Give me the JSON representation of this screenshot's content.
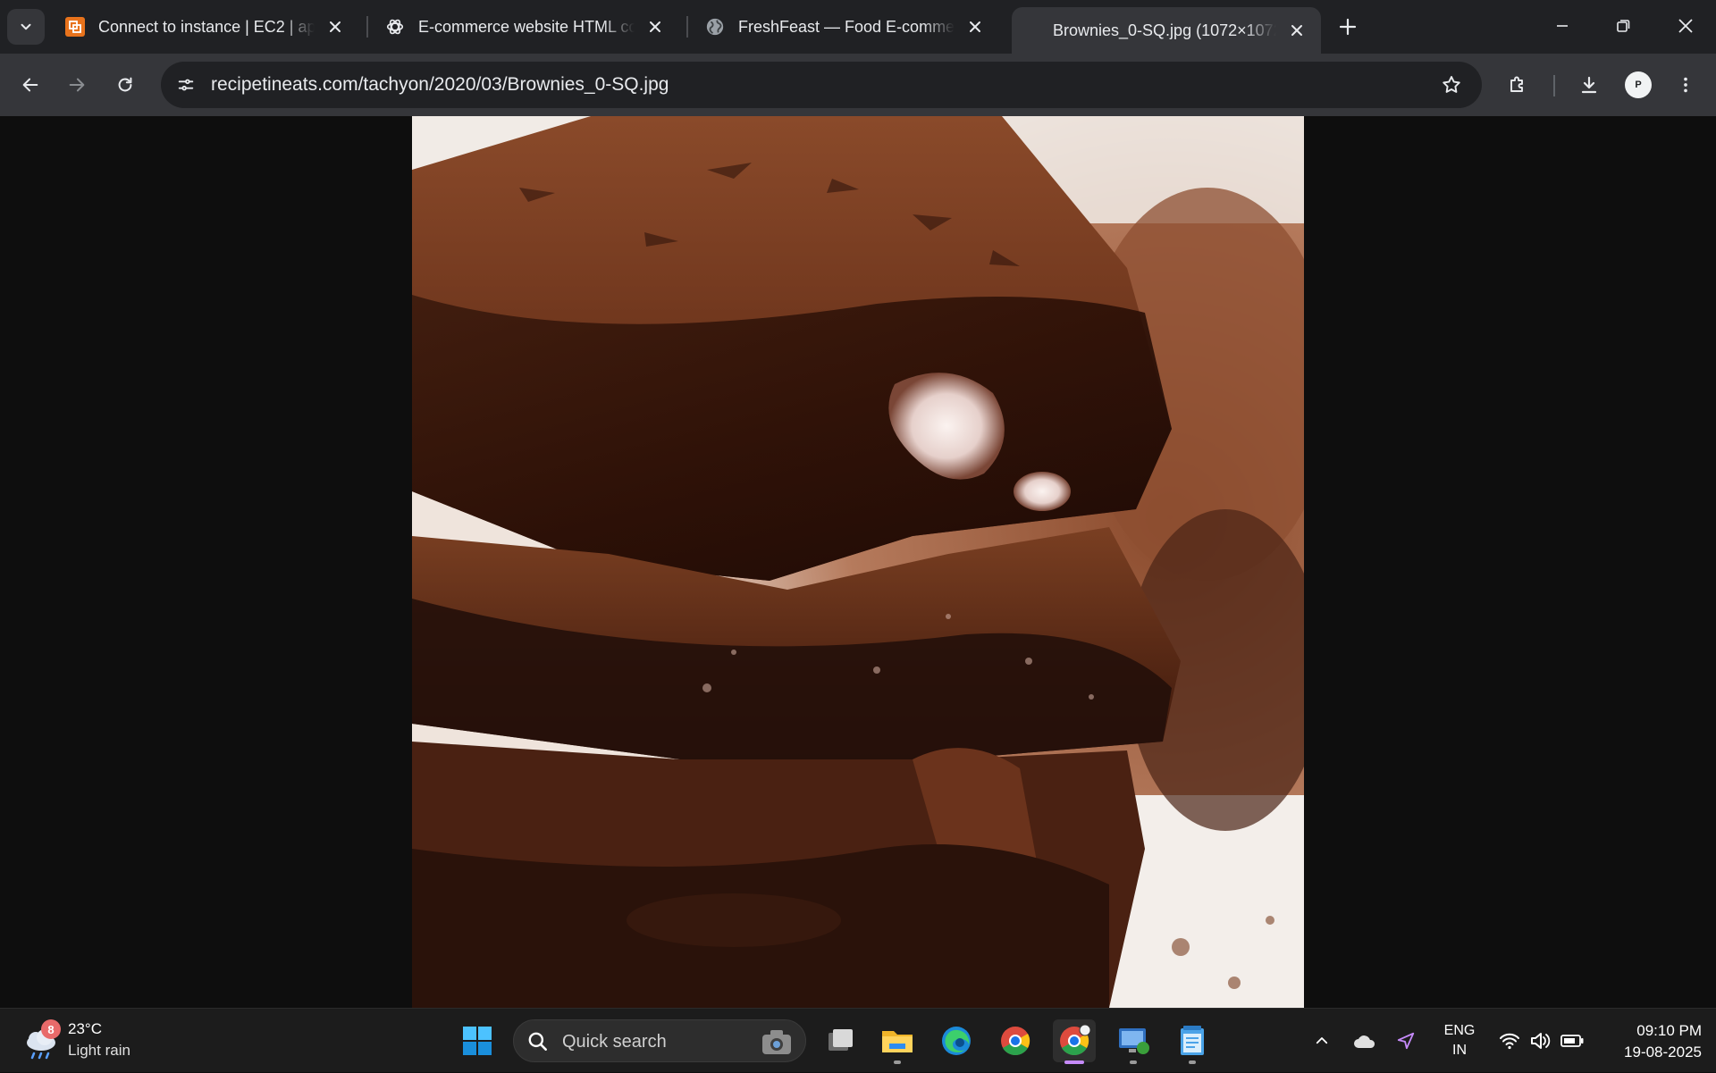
{
  "browser": {
    "tabs": [
      {
        "title": "Connect to instance | EC2 | ap-s",
        "favicon": "aws-icon",
        "active": false
      },
      {
        "title": "E-commerce website HTML cod",
        "favicon": "chatgpt-icon",
        "active": false
      },
      {
        "title": "FreshFeast — Food E-commerc",
        "favicon": "globe-icon",
        "active": false
      },
      {
        "title": "Brownies_0-SQ.jpg (1072×1072",
        "favicon": "",
        "active": true
      }
    ],
    "url": "recipetineats.com/tachyon/2020/03/Brownies_0-SQ.jpg",
    "profile_initial": "P",
    "colors": {
      "frame": "#202124",
      "toolbar": "#35363a",
      "omnibox": "#202124"
    }
  },
  "taskbar": {
    "weather": {
      "badge": "8",
      "temperature": "23°C",
      "condition": "Light rain"
    },
    "search": {
      "placeholder": "Quick search"
    },
    "tray": {
      "lang_line1": "ENG",
      "lang_line2": "IN"
    },
    "clock": {
      "time": "09:10 PM",
      "date": "19-08-2025"
    }
  }
}
